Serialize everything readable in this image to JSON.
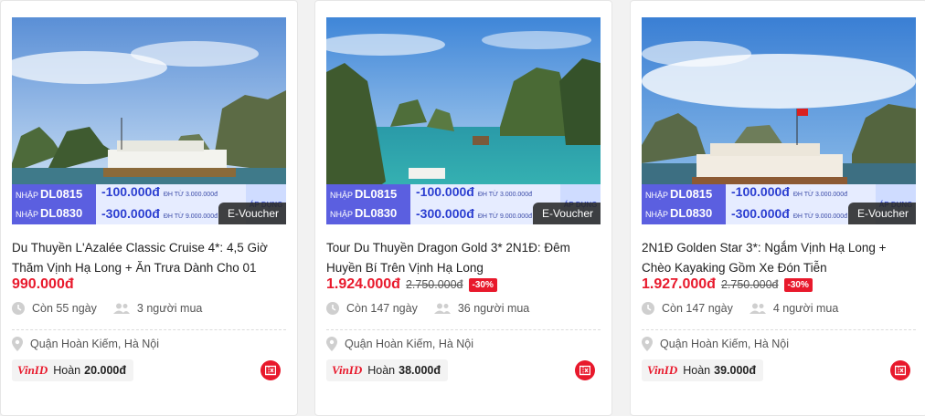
{
  "cards": [
    {
      "title": "Du Thuyền L'Azalée Classic Cruise 4*: 4,5 Giờ Thăm Vịnh Hạ Long + Ăn Trưa Dành Cho 01",
      "price": "990.000đ",
      "old_price": "",
      "discount": "",
      "days_left": "Còn 55 ngày",
      "buyers": "3 người mua",
      "location": "Quận Hoàn Kiếm, Hà Nội",
      "vinid_logo": "VinID",
      "cashback_label": "Hoàn",
      "cashback": "20.000đ",
      "evoucher": "E-Voucher",
      "voucher": {
        "prefix": "NHẬP",
        "code1": "DL0815",
        "code2": "DL0830",
        "value1": "-100.000đ",
        "value2": "-300.000đ",
        "cond1": "ĐH TỪ 3.000.000đ",
        "cond2": "ĐH TỪ 9.000.000đ",
        "apply": "ÁP DỤNG"
      }
    },
    {
      "title": "Tour Du Thuyền Dragon Gold 3* 2N1Đ: Đêm Huyền Bí Trên Vịnh Hạ Long",
      "price": "1.924.000đ",
      "old_price": "2.750.000đ",
      "discount": "-30%",
      "days_left": "Còn 147 ngày",
      "buyers": "36 người mua",
      "location": "Quận Hoàn Kiếm, Hà Nội",
      "vinid_logo": "VinID",
      "cashback_label": "Hoàn",
      "cashback": "38.000đ",
      "evoucher": "E-Voucher",
      "voucher": {
        "prefix": "NHẬP",
        "code1": "DL0815",
        "code2": "DL0830",
        "value1": "-100.000đ",
        "value2": "-300.000đ",
        "cond1": "ĐH TỪ 3.000.000đ",
        "cond2": "ĐH TỪ 9.000.000đ",
        "apply": "ÁP DỤNG"
      }
    },
    {
      "title": "2N1Đ Golden Star 3*: Ngắm Vịnh Hạ Long + Chèo Kayaking Gồm Xe Đón Tiễn",
      "price": "1.927.000đ",
      "old_price": "2.750.000đ",
      "discount": "-30%",
      "days_left": "Còn 147 ngày",
      "buyers": "4 người mua",
      "location": "Quận Hoàn Kiếm, Hà Nội",
      "vinid_logo": "VinID",
      "cashback_label": "Hoàn",
      "cashback": "39.000đ",
      "evoucher": "E-Voucher",
      "voucher": {
        "prefix": "NHẬP",
        "code1": "DL0815",
        "code2": "DL0830",
        "value1": "-100.000đ",
        "value2": "-300.000đ",
        "cond1": "ĐH TỪ 3.000.000đ",
        "cond2": "ĐH TỪ 9.000.000đ",
        "apply": "ÁP DỤNG"
      }
    }
  ],
  "colors": {
    "price": "#e8192c",
    "voucher_code_bg": "#5b5fe0",
    "voucher_value_bg": "#e6ecff"
  },
  "icons": {
    "days": "clock-icon",
    "buyers": "people-icon",
    "location": "location-pin-icon",
    "badge": "voucher-badge-icon"
  }
}
